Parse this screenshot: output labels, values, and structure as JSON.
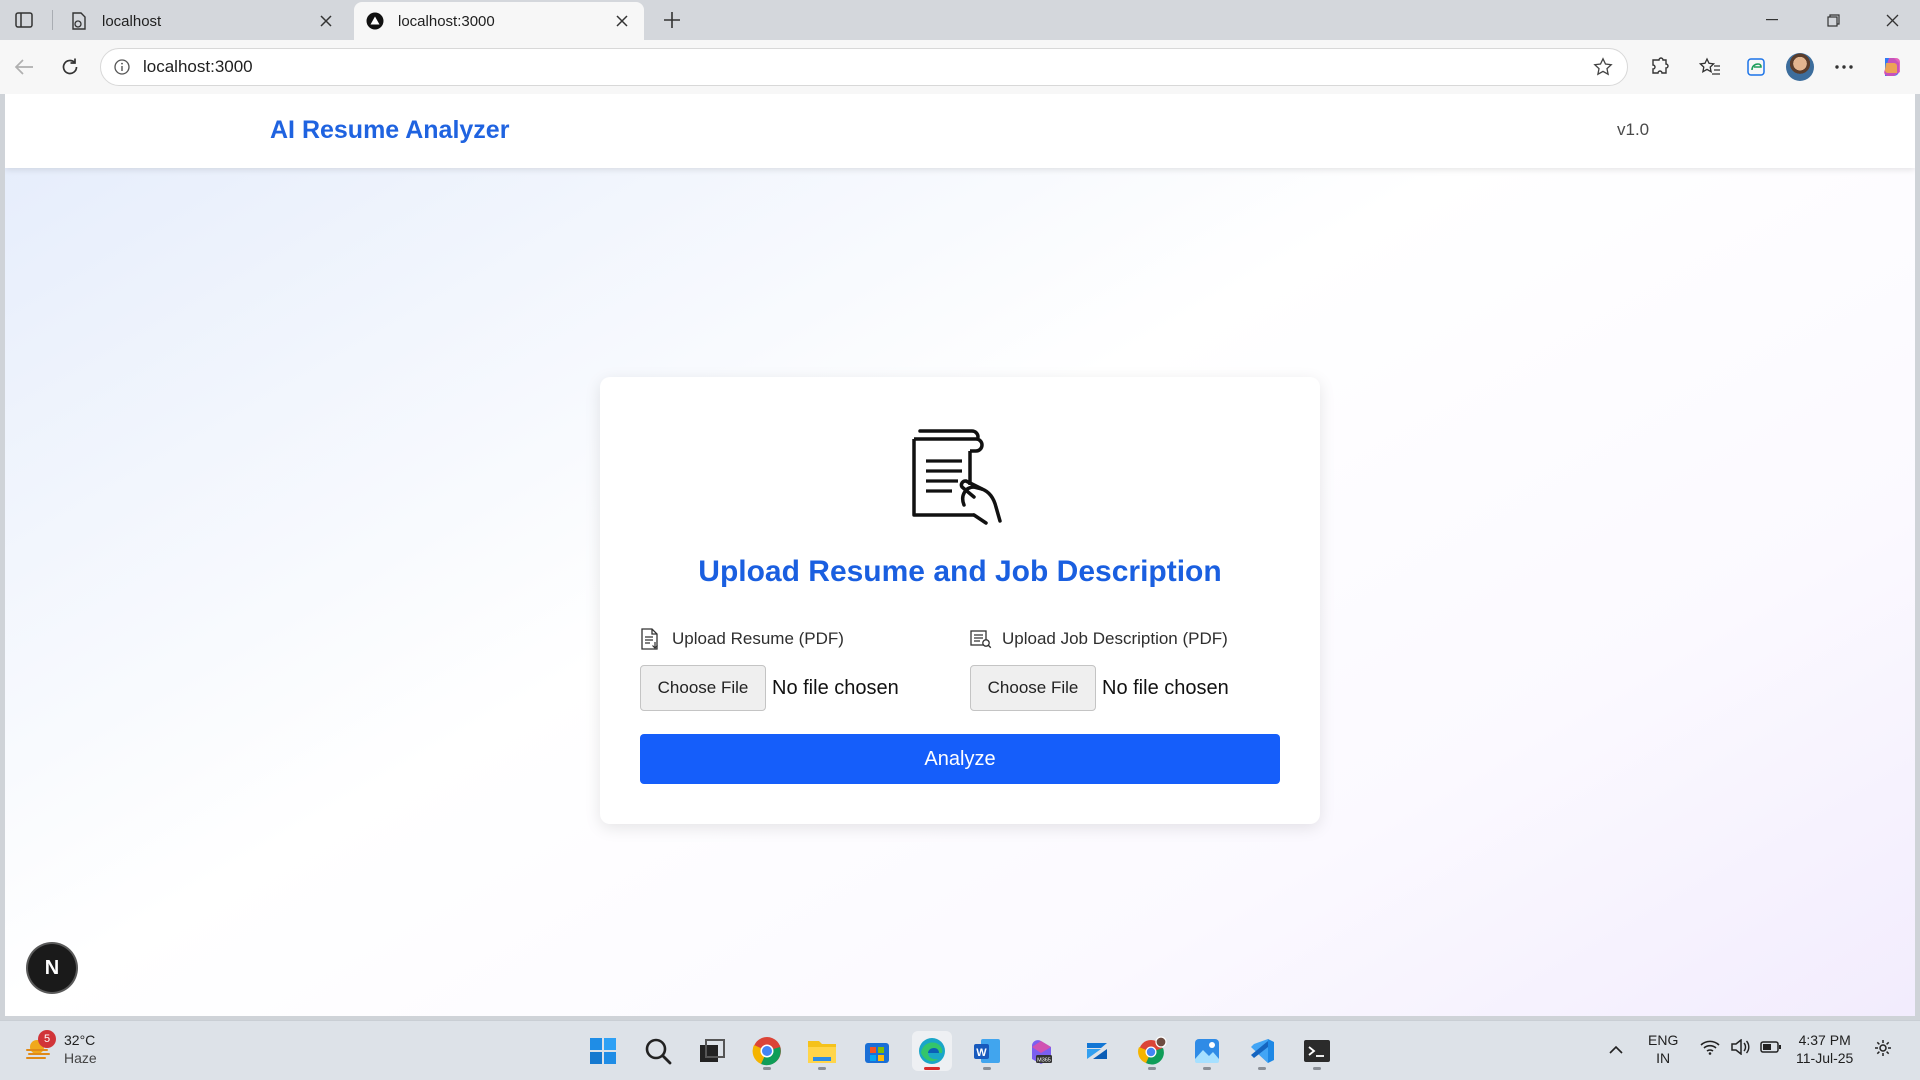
{
  "browser": {
    "tabs": [
      {
        "label": "localhost",
        "active": false
      },
      {
        "label": "localhost:3000",
        "active": true
      }
    ],
    "address": "localhost:3000"
  },
  "app": {
    "title": "AI Resume Analyzer",
    "version": "v1.0"
  },
  "upload_card": {
    "heading": "Upload Resume and Job Description",
    "resume": {
      "label": "Upload Resume (PDF)",
      "button": "Choose File",
      "status": "No file chosen"
    },
    "job_description": {
      "label": "Upload Job Description (PDF)",
      "button": "Choose File",
      "status": "No file chosen"
    },
    "analyze_label": "Analyze",
    "accent_color": "#155efa"
  },
  "dev_badge": {
    "letter": "N"
  },
  "taskbar": {
    "weather": {
      "badge": "5",
      "temp": "32°C",
      "condition": "Haze"
    },
    "apps": [
      "start-icon",
      "search-icon",
      "task-view-icon",
      "chrome-icon",
      "file-explorer-icon",
      "store-icon",
      "edge-icon",
      "word-icon",
      "m365-icon",
      "onedrive-icon",
      "chrome-profile-icon",
      "photos-icon",
      "vscode-icon",
      "terminal-icon"
    ],
    "language": {
      "line1": "ENG",
      "line2": "IN"
    },
    "clock": {
      "time": "4:37 PM",
      "date": "11-Jul-25"
    }
  }
}
